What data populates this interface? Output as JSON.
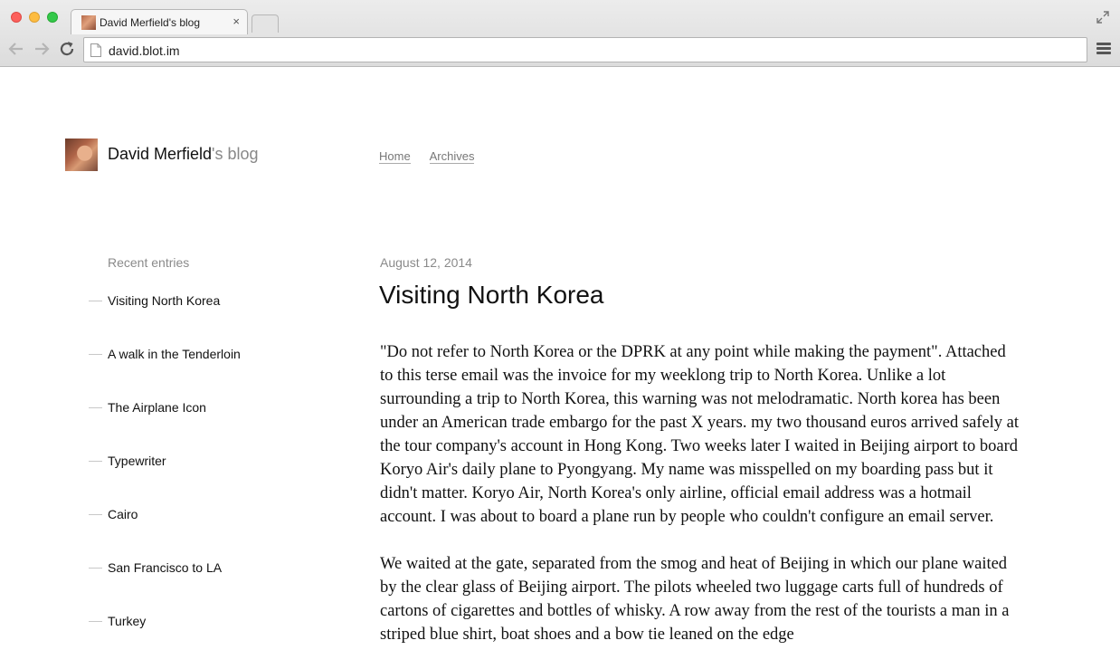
{
  "browser": {
    "tab": {
      "title": "David Merfield's blog",
      "close": "×"
    },
    "address": "david.blot.im"
  },
  "site": {
    "name": "David Merfield",
    "suffix": "'s blog",
    "nav": [
      {
        "label": "Home"
      },
      {
        "label": "Archives"
      }
    ]
  },
  "sidebar": {
    "heading": "Recent entries",
    "entries": [
      {
        "label": "Visiting North Korea"
      },
      {
        "label": "A walk in the Tenderloin"
      },
      {
        "label": "The Airplane Icon"
      },
      {
        "label": "Typewriter"
      },
      {
        "label": "Cairo"
      },
      {
        "label": "San Francisco to LA"
      },
      {
        "label": "Turkey"
      }
    ]
  },
  "post": {
    "date": "August 12, 2014",
    "title": "Visiting North Korea",
    "paragraphs": [
      "\"Do not refer to North Korea or the DPRK at any point while making the payment\". Attached to this terse email was the invoice for my weeklong trip to North Korea. Unlike a lot surrounding a trip to North Korea, this warning was not melodramatic. North korea has been under an American trade embargo for the past X years. my two thousand euros arrived safely at the tour company's account in Hong Kong. Two weeks later I waited in Beijing airport to board Koryo Air's daily plane to Pyongyang. My name was misspelled on my boarding pass but it didn't matter. Koryo Air, North Korea's only airline, official email address was a hotmail account. I was about to board a plane run by people who couldn't configure an email server.",
      "We waited at the gate, separated from the smog and heat of Beijing in which our plane waited by the clear glass of Beijing airport. The pilots wheeled two luggage carts full of hundreds of cartons of cigarettes and bottles of whisky. A row away from the rest of the tourists a man in a striped blue shirt, boat shoes and a bow tie leaned on the edge"
    ]
  }
}
